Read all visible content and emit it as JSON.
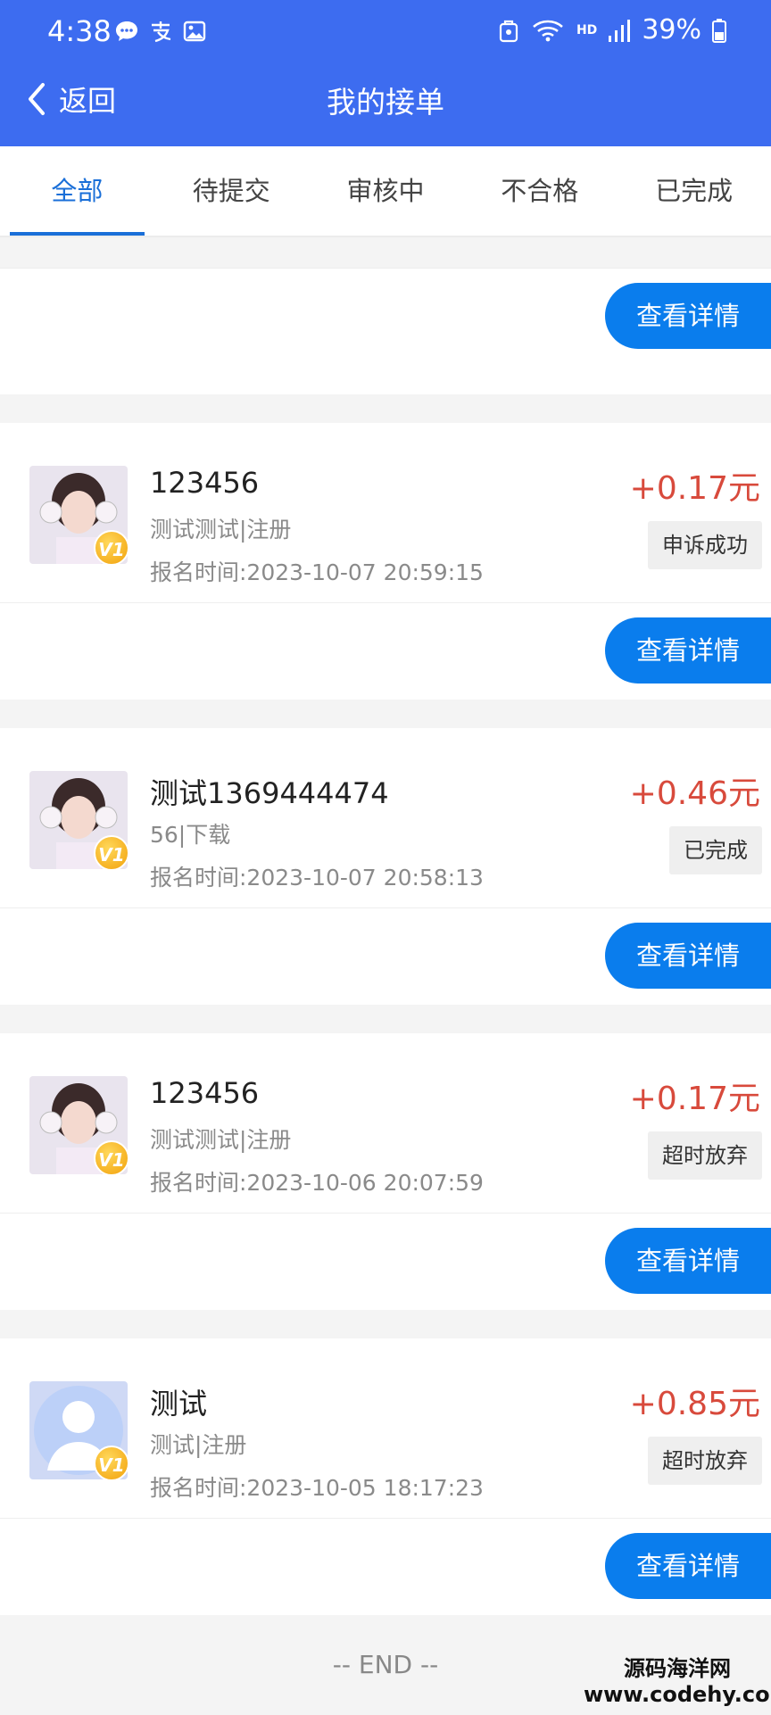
{
  "status_bar": {
    "time": "4:38",
    "battery": "39%",
    "icons_left": [
      "chat-bubble-icon",
      "alipay-icon",
      "gallery-icon"
    ],
    "icons_right": [
      "bag-icon",
      "wifi-icon",
      "hd-icon",
      "signal-icon",
      "battery-icon"
    ]
  },
  "nav": {
    "back_label": "返回",
    "title": "我的接单"
  },
  "tabs": [
    {
      "label": "全部",
      "active": true
    },
    {
      "label": "待提交",
      "active": false
    },
    {
      "label": "审核中",
      "active": false
    },
    {
      "label": "不合格",
      "active": false
    },
    {
      "label": "已完成",
      "active": false
    }
  ],
  "detail_button_label": "查看详情",
  "orders": [
    {
      "name": "123456",
      "desc": "测试测试|注册",
      "time": "报名时间:2023-10-07 20:59:15",
      "amount": "+0.17元",
      "status": "申诉成功",
      "avatar": "girl"
    },
    {
      "name": "测试1369444474",
      "desc": "56|下载",
      "time": "报名时间:2023-10-07 20:58:13",
      "amount": "+0.46元",
      "status": "已完成",
      "avatar": "girl"
    },
    {
      "name": "123456",
      "desc": "测试测试|注册",
      "time": "报名时间:2023-10-06 20:07:59",
      "amount": "+0.17元",
      "status": "超时放弃",
      "avatar": "girl"
    },
    {
      "name": "测试",
      "desc": "测试|注册",
      "time": "报名时间:2023-10-05 18:17:23",
      "amount": "+0.85元",
      "status": "超时放弃",
      "avatar": "default"
    }
  ],
  "badge_text": "V1",
  "end_text": "-- END --",
  "watermark": {
    "line1": "源码海洋网",
    "line2": "www.codehy.com"
  },
  "colors": {
    "header": "#3d6cf0",
    "accent": "#1a6fd8",
    "button": "#0a7ded",
    "amount": "#d84a3c"
  }
}
